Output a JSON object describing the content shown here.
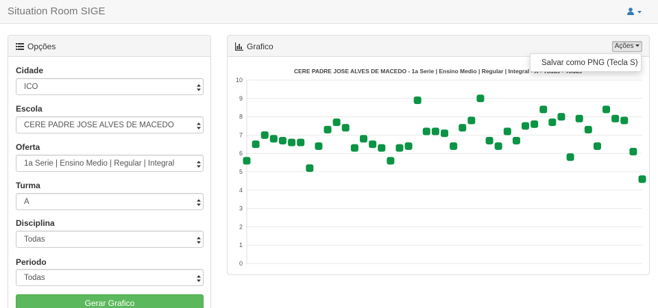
{
  "app": {
    "title": "Situation Room SIGE"
  },
  "options": {
    "heading": "Opções",
    "fields": [
      {
        "label": "Cidade",
        "value": "ICO"
      },
      {
        "label": "Escola",
        "value": "CERE PADRE JOSE ALVES DE MACEDO"
      },
      {
        "label": "Oferta",
        "value": "1a Serie | Ensino Medio | Regular | Integral"
      },
      {
        "label": "Turma",
        "value": "A"
      },
      {
        "label": "Disciplina",
        "value": "Todas"
      },
      {
        "label": "Periodo",
        "value": "Todas"
      }
    ],
    "submit_label": "Gerar Grafico"
  },
  "chart_panel": {
    "heading": "Grafico",
    "actions_label": "Ações",
    "menu_item": "Salvar como PNG (Tecla S)"
  },
  "chart_data": {
    "type": "scatter",
    "title": "CERE PADRE JOSE ALVES DE MACEDO - 1a Serie | Ensino Medio | Regular | Integral - A - Todas - Todas",
    "xlabel": "",
    "ylabel": "",
    "ylim": [
      0,
      10
    ],
    "yticks": [
      "0",
      "1",
      "2",
      "3",
      "4",
      "5",
      "6",
      "7",
      "8",
      "9",
      "10"
    ],
    "grid": true,
    "point_color": "#0b9444",
    "values": [
      5.6,
      6.5,
      7.0,
      6.8,
      6.7,
      6.6,
      6.6,
      5.2,
      6.4,
      7.3,
      7.7,
      7.4,
      6.3,
      6.8,
      6.5,
      6.3,
      5.6,
      6.3,
      6.4,
      8.9,
      7.2,
      7.2,
      7.1,
      6.4,
      7.4,
      7.8,
      9.0,
      6.7,
      6.4,
      7.2,
      6.7,
      7.5,
      7.6,
      8.4,
      7.7,
      8.0,
      5.8,
      7.9,
      7.3,
      6.4,
      8.4,
      7.9,
      7.8,
      6.1,
      4.6
    ]
  }
}
